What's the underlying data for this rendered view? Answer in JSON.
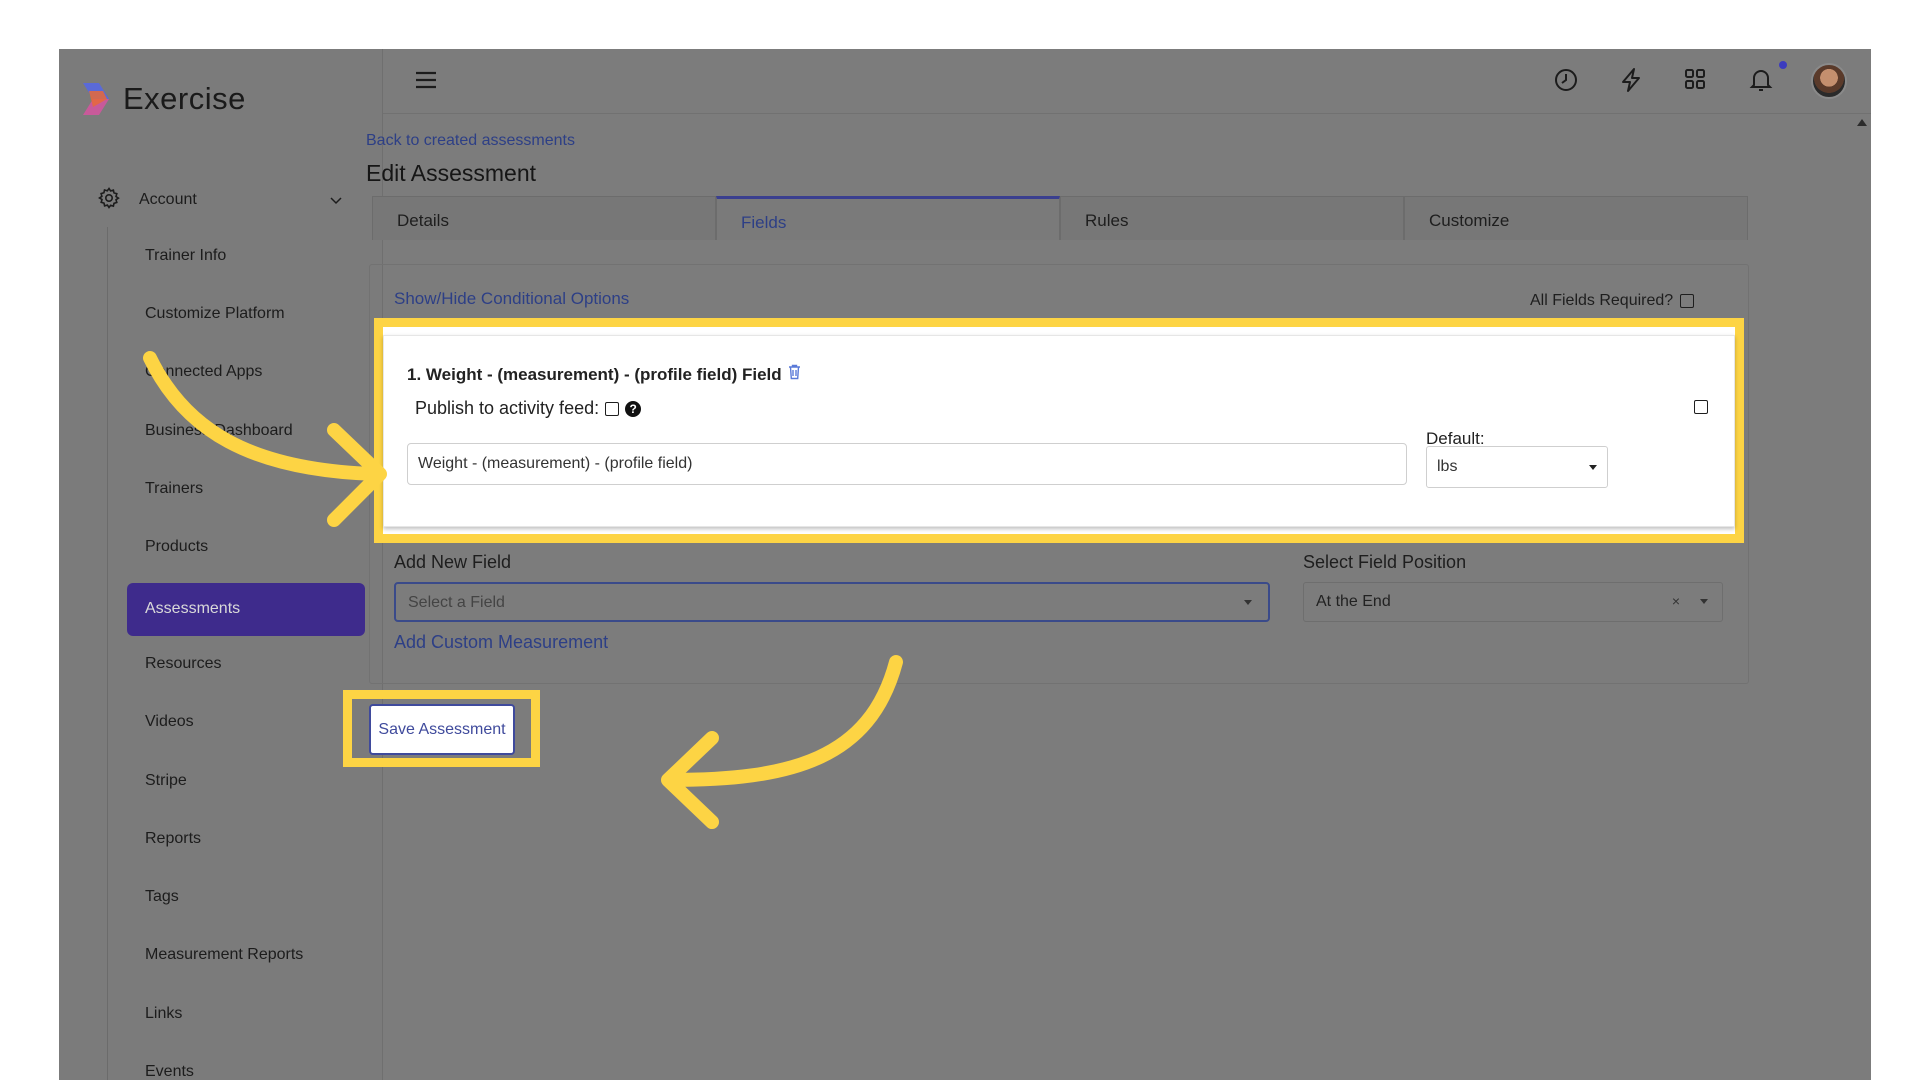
{
  "app": {
    "name": "Exercise"
  },
  "sidebar": {
    "account_label": "Account",
    "items": [
      {
        "label": "Trainer Info"
      },
      {
        "label": "Customize Platform"
      },
      {
        "label": "Connected Apps"
      },
      {
        "label": "Business Dashboard"
      },
      {
        "label": "Trainers"
      },
      {
        "label": "Products"
      },
      {
        "label": "Assessments",
        "active": true
      },
      {
        "label": "Resources"
      },
      {
        "label": "Videos"
      },
      {
        "label": "Stripe"
      },
      {
        "label": "Reports"
      },
      {
        "label": "Tags"
      },
      {
        "label": "Measurement Reports"
      },
      {
        "label": "Links"
      },
      {
        "label": "Events"
      }
    ],
    "active_color": "#3e2b8c"
  },
  "topbar": {
    "icons": [
      "menu-icon",
      "clock-icon",
      "lightning-icon",
      "apps-grid-icon",
      "bell-icon",
      "avatar"
    ]
  },
  "main": {
    "back_link": "Back to created assessments",
    "title": "Edit Assessment",
    "tabs": [
      {
        "label": "Details"
      },
      {
        "label": "Fields",
        "active": true
      },
      {
        "label": "Rules"
      },
      {
        "label": "Customize"
      }
    ],
    "toggle_conditional": "Show/Hide Conditional Options",
    "all_fields_required": "All Fields Required?",
    "field": {
      "title": "1. Weight - (measurement) - (profile field) Field",
      "publish_label": "Publish to activity feed:",
      "input_value": "Weight - (measurement) - (profile field)",
      "default_label": "Default:",
      "default_value": "lbs"
    },
    "add_new_field_label": "Add New Field",
    "add_new_field_placeholder": "Select a Field",
    "select_position_label": "Select Field Position",
    "select_position_value": "At the End",
    "add_custom_measurement": "Add Custom Measurement",
    "save_button": "Save Assessment"
  },
  "colors": {
    "highlight": "#fdd444",
    "link": "#2d3f86",
    "overlay": "#7c7c7c"
  }
}
